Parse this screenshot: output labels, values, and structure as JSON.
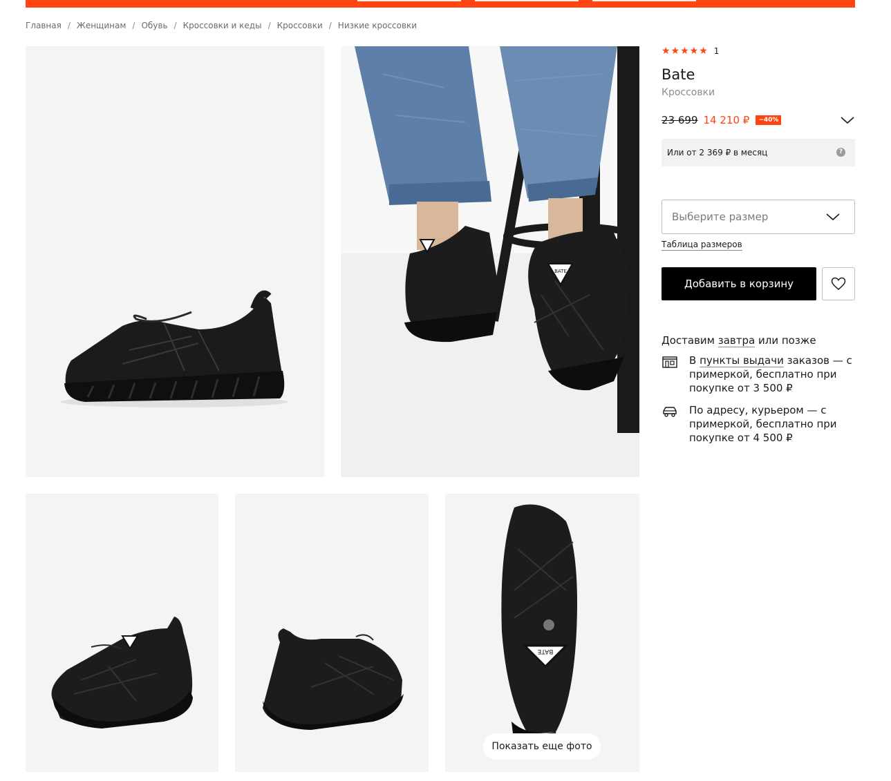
{
  "breadcrumb": [
    "Главная",
    "Женщинам",
    "Обувь",
    "Кроссовки и кеды",
    "Кроссовки",
    "Низкие кроссовки"
  ],
  "product": {
    "rating_stars": "★★★★★",
    "rating_value": 5,
    "rating_count": "1",
    "brand": "Bate",
    "type": "Кроссовки",
    "old_price": "23 699",
    "new_price": "14 210 ₽",
    "discount": "−40%",
    "installment": "Или от 2 369 ₽ в месяц",
    "installment_help": "?"
  },
  "size": {
    "placeholder": "Выберите размер",
    "table_link": "Таблица размеров"
  },
  "actions": {
    "add_to_cart": "Добавить в корзину"
  },
  "delivery": {
    "title_prefix": "Доставим ",
    "title_link": "завтра",
    "title_suffix": " или позже",
    "pickup": {
      "prefix": "В ",
      "link": "пункты выдачи",
      "suffix": " заказов — с примеркой, бесплатно при покупке от 3 500 ₽"
    },
    "courier": {
      "text": "По адресу, курьером — с примеркой, бесплатно при покупке от 4 500 ₽"
    }
  },
  "gallery": {
    "show_more": "Показать еще фото",
    "logo_text": "BATE"
  },
  "colors": {
    "accent": "#ff4411",
    "button": "#000000",
    "photo_bg": "#f4f4f4"
  }
}
